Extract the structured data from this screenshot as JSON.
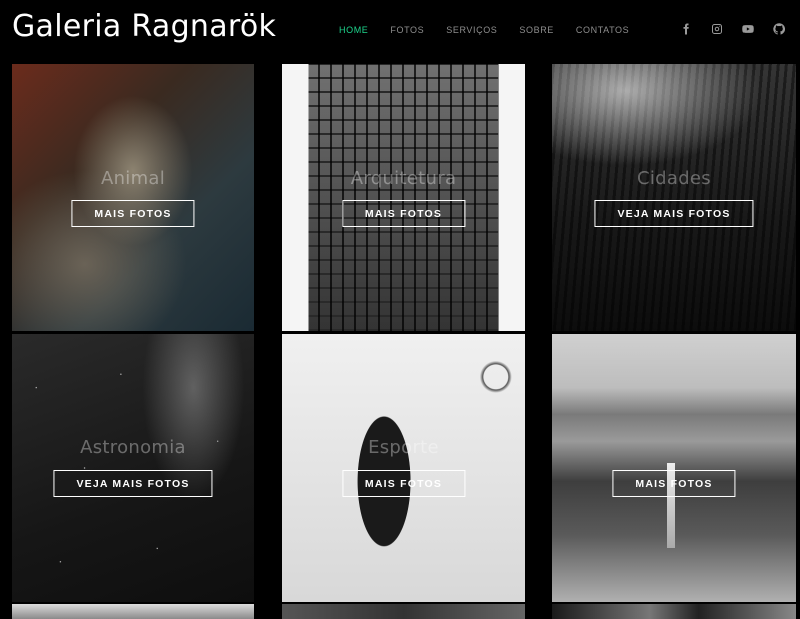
{
  "header": {
    "brand": "Galeria Ragnarök",
    "nav": [
      {
        "label": "HOME",
        "active": true
      },
      {
        "label": "FOTOS",
        "active": false
      },
      {
        "label": "SERVIÇOS",
        "active": false
      },
      {
        "label": "SOBRE",
        "active": false
      },
      {
        "label": "CONTATOS",
        "active": false
      }
    ],
    "social_icons": [
      "facebook-icon",
      "instagram-icon",
      "youtube-icon",
      "github-icon"
    ]
  },
  "colors": {
    "background": "#000000",
    "accent": "#1ed68e",
    "nav_text": "#8e8e8e"
  },
  "gallery": {
    "tiles": [
      {
        "title": "Animal",
        "button": "MAIS FOTOS"
      },
      {
        "title": "Arquitetura",
        "button": "MAIS FOTOS"
      },
      {
        "title": "Cidades",
        "button": "VEJA MAIS FOTOS"
      },
      {
        "title": "Astronomia",
        "button": "VEJA MAIS FOTOS"
      },
      {
        "title": "Esporte",
        "button": "MAIS FOTOS"
      },
      {
        "title": "",
        "button": "MAIS FOTOS"
      }
    ]
  }
}
